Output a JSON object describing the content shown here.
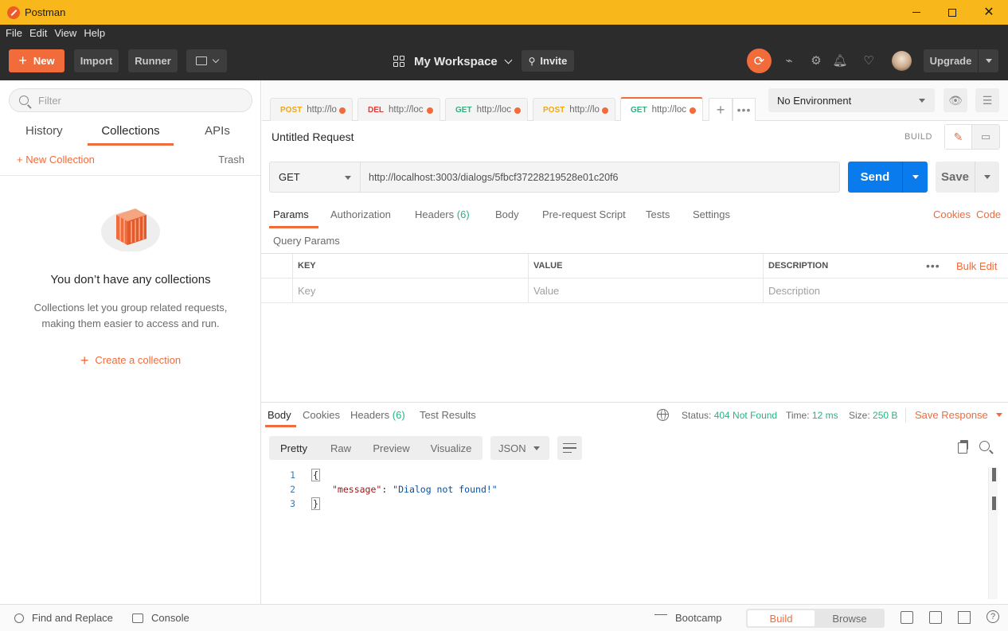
{
  "window": {
    "title": "Postman"
  },
  "menu": [
    "File",
    "Edit",
    "View",
    "Help"
  ],
  "header": {
    "new_label": "New",
    "import_label": "Import",
    "runner_label": "Runner",
    "workspace_label": "My Workspace",
    "invite_label": "Invite",
    "upgrade_label": "Upgrade"
  },
  "sidebar": {
    "filter_placeholder": "Filter",
    "tabs": [
      "History",
      "Collections",
      "APIs"
    ],
    "active_tab": "Collections",
    "new_collection_label": "+ New Collection",
    "trash_label": "Trash",
    "empty_title": "You don’t have any collections",
    "empty_desc": "Collections let you group related requests, making them easier to access and run.",
    "create_label": "Create a collection"
  },
  "request_tabs": [
    {
      "method": "POST",
      "url": "http://lo",
      "color": "#f4a70b"
    },
    {
      "method": "DEL",
      "url": "http://loc",
      "color": "#e53935"
    },
    {
      "method": "GET",
      "url": "http://loc",
      "color": "#26b47f"
    },
    {
      "method": "POST",
      "url": "http://lo",
      "color": "#f4a70b"
    },
    {
      "method": "GET",
      "url": "http://loc",
      "color": "#26b47f"
    }
  ],
  "environment": {
    "selected": "No Environment"
  },
  "request": {
    "name": "Untitled Request",
    "build_label": "BUILD",
    "method": "GET",
    "url": "http://localhost:3003/dialogs/5fbcf37228219528e01c20f6",
    "send_label": "Send",
    "save_label": "Save"
  },
  "request_subtabs": {
    "params": "Params",
    "authorization": "Authorization",
    "headers": "Headers",
    "headers_count": "(6)",
    "body": "Body",
    "prerequest": "Pre-request Script",
    "tests": "Tests",
    "settings": "Settings",
    "cookies": "Cookies",
    "code": "Code"
  },
  "query_params": {
    "title": "Query Params",
    "columns": [
      "KEY",
      "VALUE",
      "DESCRIPTION"
    ],
    "placeholders": [
      "Key",
      "Value",
      "Description"
    ],
    "bulk_edit": "Bulk Edit",
    "more": "•••"
  },
  "response": {
    "tabs": {
      "body": "Body",
      "cookies": "Cookies",
      "headers": "Headers",
      "headers_count": "(6)",
      "tests": "Test Results"
    },
    "status_label": "Status:",
    "status_value": "404 Not Found",
    "time_label": "Time:",
    "time_value": "12 ms",
    "size_label": "Size:",
    "size_value": "250 B",
    "save_label": "Save Response",
    "formats": [
      "Pretty",
      "Raw",
      "Preview",
      "Visualize"
    ],
    "active_format": "Pretty",
    "language": "JSON",
    "body_lines": [
      {
        "n": "1",
        "text": "{"
      },
      {
        "n": "2",
        "key": "\"message\"",
        "value": "\"Dialog not found!\""
      },
      {
        "n": "3",
        "text": "}"
      }
    ]
  },
  "statusbar": {
    "find_replace": "Find and Replace",
    "console": "Console",
    "bootcamp": "Bootcamp",
    "build": "Build",
    "browse": "Browse"
  }
}
